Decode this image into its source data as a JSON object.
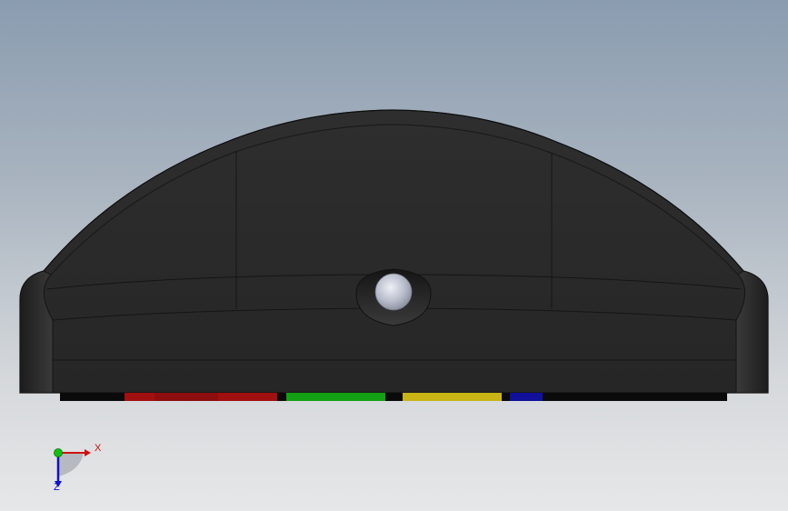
{
  "view": {
    "background_top": "#8a9cb0",
    "background_bottom": "#e6e7e8",
    "model_color": "#2b2b2b",
    "edge_color": "#111111",
    "sensor_color": "#c8ccd6"
  },
  "stripe_colors": {
    "red": "#a01010",
    "green": "#14a014",
    "yellow": "#c8b414",
    "blue": "#10109a",
    "black": "#0a0a0a"
  },
  "triad": {
    "x_label": "X",
    "z_label": "Z",
    "x_color": "#d01010",
    "y_color": "#10c010",
    "z_color": "#1010d0"
  }
}
